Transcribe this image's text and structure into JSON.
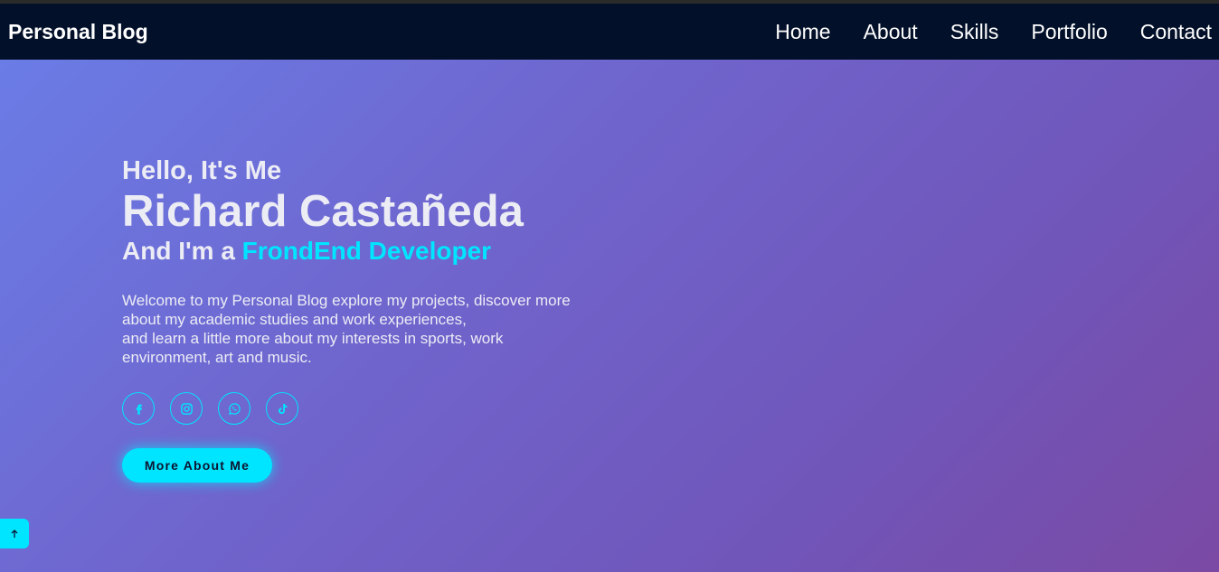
{
  "header": {
    "brand": "Personal Blog",
    "nav": [
      "Home",
      "About",
      "Skills",
      "Portfolio",
      "Contact"
    ]
  },
  "hero": {
    "greeting": "Hello, It's Me",
    "name": "Richard Castañeda",
    "role_prefix": "And I'm a ",
    "role_highlight": "FrondEnd Developer",
    "description_lines": [
      "Welcome to my Personal Blog explore my projects, discover more",
      "about my academic studies and work experiences,",
      "and learn a little more about my interests in sports, work",
      "environment, art and music."
    ],
    "socials": [
      "facebook-icon",
      "instagram-icon",
      "whatsapp-icon",
      "tiktok-icon"
    ],
    "cta_label": "More About Me"
  },
  "scroll_top_icon": "arrow-up-icon",
  "colors": {
    "accent": "#00e5ff",
    "header_bg": "#031029",
    "gradient_start": "#6a7ee8",
    "gradient_end": "#7a4aa4"
  }
}
